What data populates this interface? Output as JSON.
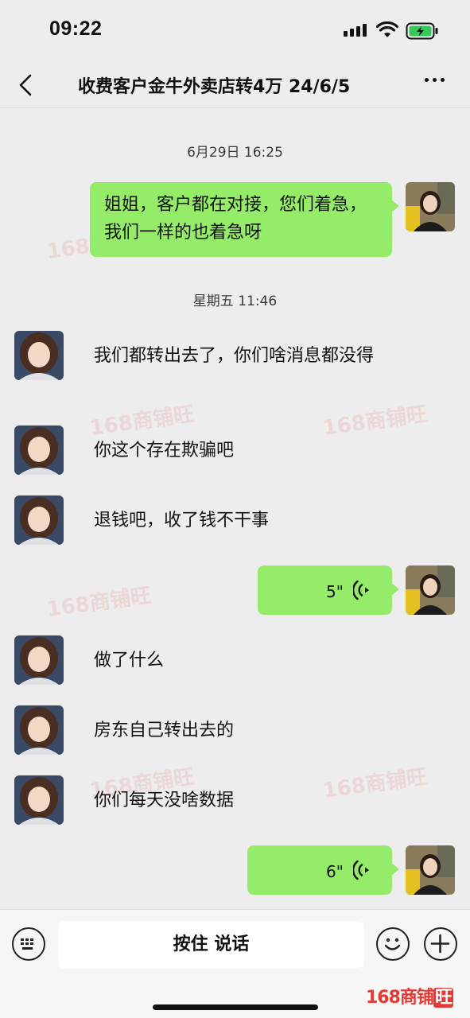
{
  "status_bar": {
    "time": "09:22"
  },
  "nav": {
    "title": "收费客户金牛外卖店转4万 24/6/5"
  },
  "chat": {
    "timestamps": [
      "6月29日 16:25",
      "星期五 11:46"
    ],
    "messages": {
      "out_1": "姐姐，客户都在对接，您们着急，我们一样的也着急呀",
      "in_1": "我们都转出去了，你们啥消息都没得",
      "in_2": "你这个存在欺骗吧",
      "in_3": "退钱吧，收了钱不干事",
      "voice_1": "5\"",
      "in_4": "做了什么",
      "in_5": "房东自己转出去的",
      "in_6": "你们每天没啥数据",
      "voice_2": "6\""
    },
    "bubble_color": "#95ec69"
  },
  "watermark": {
    "text": "168商铺旺"
  },
  "input_bar": {
    "hold_to_talk": "按住 说话"
  },
  "brand": {
    "prefix": "168商铺",
    "suffix": "旺"
  },
  "icons": [
    "back-icon",
    "more-icon",
    "keyboard-icon",
    "emoji-icon",
    "plus-icon",
    "voice-icon",
    "wifi-icon",
    "battery-icon"
  ]
}
